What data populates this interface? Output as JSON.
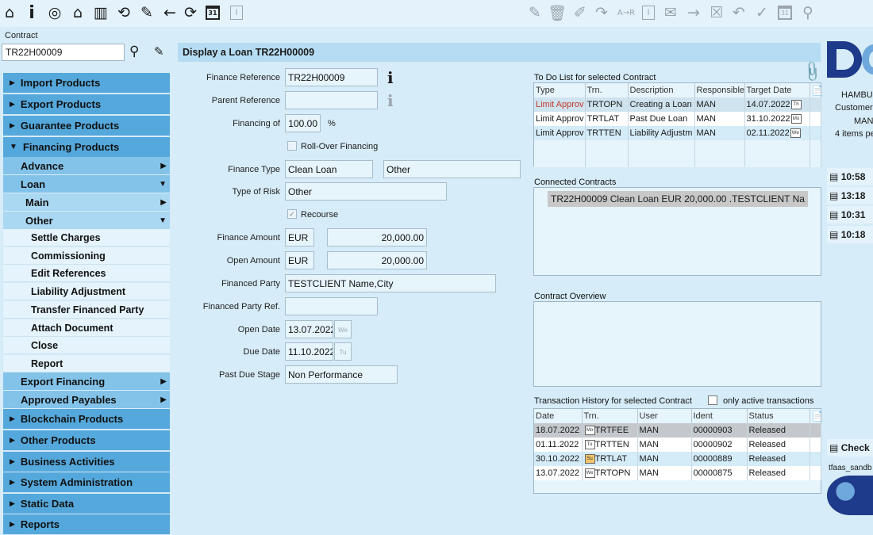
{
  "toolbar": {
    "left_icons": [
      "home-icon",
      "info-icon",
      "target-icon",
      "inbox-icon",
      "book-icon",
      "refresh-doc-icon",
      "edit-icon",
      "back-arrow-icon",
      "reload-icon",
      "calendar-icon",
      "info-box-icon"
    ],
    "right_icons": [
      "edit-doc-icon",
      "trash-icon",
      "doc-edit-icon",
      "forward-arrow-icon",
      "a-to-r-icon",
      "info-box-icon",
      "mail-icon",
      "arrow-right-icon",
      "close-box-icon",
      "undo-icon",
      "check-icon",
      "calendar-icon",
      "search-icon"
    ],
    "calendar_day": "31",
    "a_to_r": "A→R"
  },
  "contract": {
    "label": "Contract",
    "value": "TR22H00009"
  },
  "nav": {
    "import": "Import Products",
    "export": "Export Products",
    "guarantee": "Guarantee Products",
    "financing": "Financing Products",
    "advance": "Advance",
    "loan": "Loan",
    "main": "Main",
    "other": "Other",
    "leaves": [
      "Settle Charges",
      "Commissioning",
      "Edit References",
      "Liability Adjustment",
      "Transfer Financed Party",
      "Attach Document",
      "Close",
      "Report"
    ],
    "export_financing": "Export Financing",
    "approved_payables": "Approved Payables",
    "blockchain": "Blockchain Products",
    "other_products": "Other Products",
    "business": "Business Activities",
    "sysadmin": "System Administration",
    "static": "Static Data",
    "reports": "Reports"
  },
  "title": "Display a Loan TR22H00009",
  "form": {
    "finance_reference_label": "Finance Reference",
    "finance_reference": "TR22H00009",
    "parent_reference_label": "Parent Reference",
    "parent_reference": "",
    "financing_of_label": "Financing of",
    "financing_of": "100.00",
    "percent": "%",
    "rollover_label": "Roll-Over Financing",
    "finance_type_label": "Finance Type",
    "finance_type": "Clean Loan",
    "finance_type_2": "Other",
    "type_of_risk_label": "Type of Risk",
    "type_of_risk": "Other",
    "recourse_label": "Recourse",
    "finance_amount_label": "Finance Amount",
    "finance_amount_ccy": "EUR",
    "finance_amount": "20,000.00",
    "open_amount_label": "Open Amount",
    "open_amount_ccy": "EUR",
    "open_amount": "20,000.00",
    "financed_party_label": "Financed Party",
    "financed_party": "TESTCLIENT Name,City",
    "financed_party_ref_label": "Financed Party Ref.",
    "financed_party_ref": "",
    "open_date_label": "Open Date",
    "open_date": "13.07.2022",
    "open_date_day": "We",
    "due_date_label": "Due Date",
    "due_date": "11.10.2022",
    "due_date_day": "Tu",
    "past_due_label": "Past Due Stage",
    "past_due": "Non Performance"
  },
  "todo": {
    "title": "To Do List for selected Contract",
    "headers": [
      "Type",
      "Trn.",
      "Description",
      "Responsible",
      "Target Date"
    ],
    "rows": [
      [
        "Limit Approv",
        "TRTOPN",
        "Creating a Loan",
        "MAN",
        "14.07.2022",
        "Th"
      ],
      [
        "Limit Approv",
        "TRTLAT",
        "Past Due Loan",
        "MAN",
        "31.10.2022",
        "Mo"
      ],
      [
        "Limit Approv",
        "TRTTEN",
        "Liability Adjustm",
        "MAN",
        "02.11.2022",
        "We"
      ]
    ]
  },
  "connected": {
    "title": "Connected Contracts",
    "item": "TR22H00009 Clean Loan EUR 20,000.00 .TESTCLIENT Na"
  },
  "overview": {
    "title": "Contract Overview"
  },
  "history": {
    "title": "Transaction History for selected Contract",
    "only_active": "only active transactions",
    "headers": [
      "Date",
      "Trn.",
      "User",
      "Ident",
      "Status"
    ],
    "rows": [
      [
        "18.07.2022",
        "Mo",
        "TRTFEE",
        "MAN",
        "00000903",
        "Released"
      ],
      [
        "01.11.2022",
        "Tu",
        "TRTTEN",
        "MAN",
        "00000902",
        "Released"
      ],
      [
        "30.10.2022",
        "Su",
        "TRTLAT",
        "MAN",
        "00000889",
        "Released"
      ],
      [
        "13.07.2022",
        "We",
        "TRTOPN",
        "MAN",
        "00000875",
        "Released"
      ]
    ]
  },
  "right": {
    "logo": "D",
    "city": "HAMBU",
    "customer": "Customer",
    "user": "MAN",
    "items": "4 items pe",
    "times": [
      "10:58",
      "13:18",
      "10:31",
      "10:18"
    ],
    "check": "Check",
    "sandbox": "tfaas_sandb"
  },
  "colors": {
    "accent": "#55a8dc",
    "header": "#b5dcf2",
    "field": "#e6f4fc",
    "red_text": "#c0392b"
  }
}
